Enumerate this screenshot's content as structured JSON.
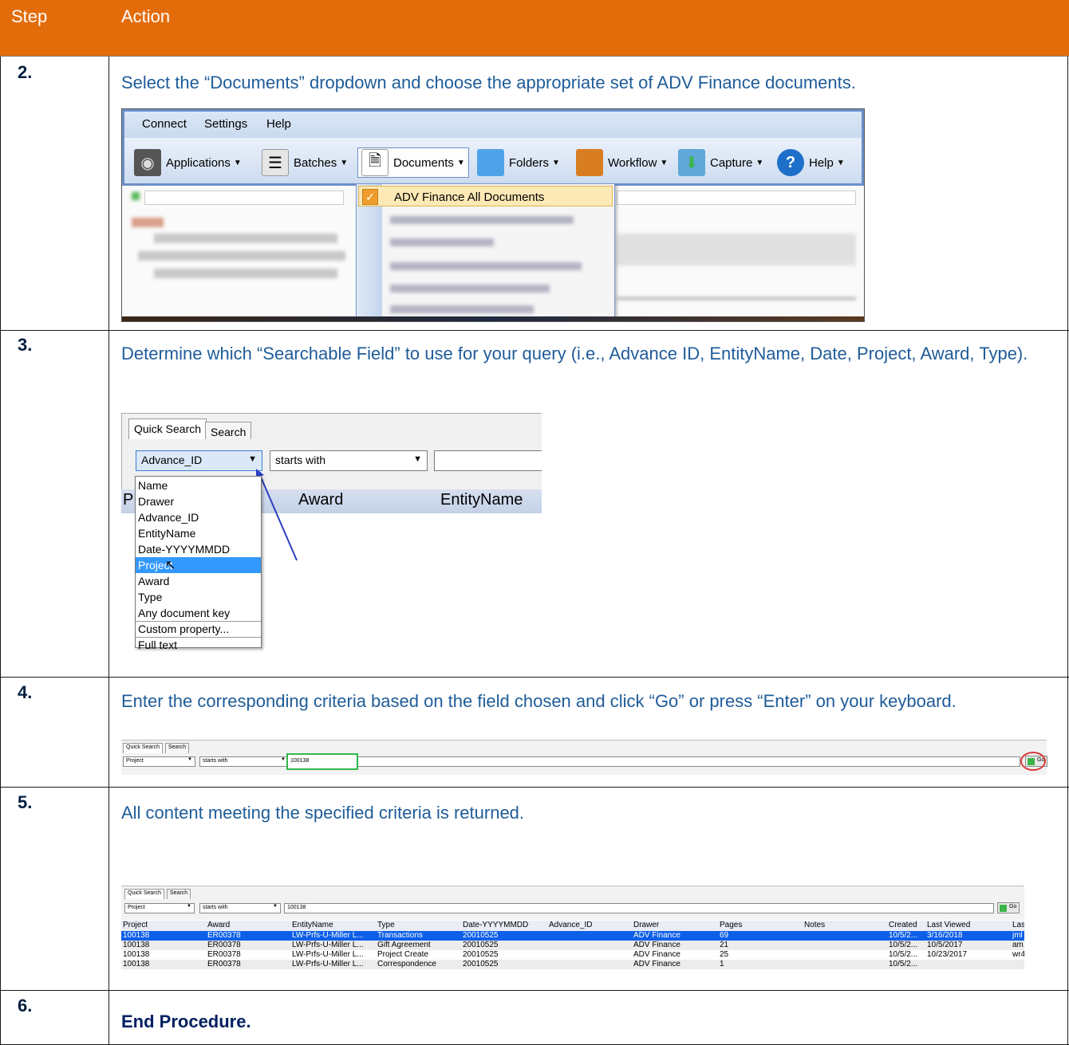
{
  "header": {
    "step": "Step",
    "action": "Action"
  },
  "steps": [
    {
      "num": "2.",
      "text": "Select the “Documents” dropdown and choose the appropriate set of ADV Finance documents."
    },
    {
      "num": "3.",
      "text": "Determine which “Searchable Field” to use for your query (i.e., Advance ID, EntityName, Date, Project, Award, Type)."
    },
    {
      "num": "4.",
      "text": "Enter the corresponding criteria based on the field chosen and click “Go” or press “Enter” on your keyboard."
    },
    {
      "num": "5.",
      "text": "All content meeting the specified criteria is returned."
    },
    {
      "num": "6.",
      "text": "End Procedure."
    }
  ],
  "shot1": {
    "menu": [
      "Connect",
      "Settings",
      "Help"
    ],
    "toolbar": [
      "Applications",
      "Batches",
      "Documents",
      "Folders",
      "Workflow",
      "Capture",
      "Help"
    ],
    "selected_item": "ADV Finance All Documents"
  },
  "shot2": {
    "tabs": [
      "Quick Search",
      "Search"
    ],
    "field_value": "Advance_ID",
    "operator_value": "starts with",
    "columns": [
      "P",
      "Award",
      "EntityName"
    ],
    "options": [
      "Name",
      "Drawer",
      "Advance_ID",
      "EntityName",
      "Date-YYYYMMDD",
      "Project",
      "Award",
      "Type",
      "Any document key",
      "Custom property...",
      "Full text"
    ],
    "highlighted": "Project"
  },
  "shot3": {
    "tabs": [
      "Quick Search",
      "Search"
    ],
    "field_value": "Project",
    "operator_value": "starts with",
    "criteria": "100138",
    "go": "Go"
  },
  "shot4": {
    "tabs": [
      "Quick Search",
      "Search"
    ],
    "field_value": "Project",
    "operator_value": "starts with",
    "criteria": "100138",
    "go": "Go",
    "columns": [
      "Project",
      "Award",
      "EntityName",
      "Type",
      "Date-YYYYMMDD",
      "Advance_ID",
      "Drawer",
      "Pages",
      "Notes",
      "Created",
      "Last Viewed",
      "Las"
    ],
    "rows": [
      [
        "100138",
        "ER00378",
        "LW-Prfs-U-Miller L...",
        "Transactions",
        "20010525",
        "",
        "ADV Finance",
        "69",
        "",
        "10/5/2...",
        "3/16/2018",
        "jml"
      ],
      [
        "100138",
        "ER00378",
        "LW-Prfs-U-Miller L...",
        "Gift Agreement",
        "20010525",
        "",
        "ADV Finance",
        "21",
        "",
        "10/5/2...",
        "10/5/2017",
        "am"
      ],
      [
        "100138",
        "ER00378",
        "LW-Prfs-U-Miller L...",
        "Project Create",
        "20010525",
        "",
        "ADV Finance",
        "25",
        "",
        "10/5/2...",
        "10/23/2017",
        "wr4"
      ],
      [
        "100138",
        "ER00378",
        "LW-Prfs-U-Miller L...",
        "Correspondence",
        "20010525",
        "",
        "ADV Finance",
        "1",
        "",
        "10/5/2...",
        "",
        ""
      ]
    ]
  },
  "colors": {
    "header_bg": "#e36c0a",
    "action_text": "#1f5c99",
    "selection_blue": "#0d5fe8"
  }
}
